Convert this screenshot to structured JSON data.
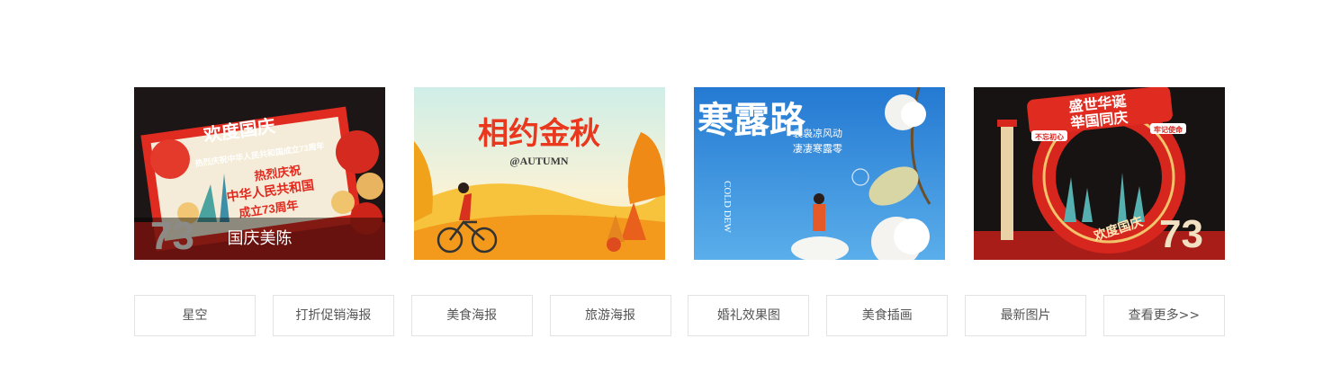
{
  "cards": [
    {
      "caption": "国庆美陈",
      "headline": "欢度国庆",
      "subline": "热烈庆祝中华人民共和国成立73周年",
      "board_line_1": "热烈庆祝",
      "board_line_2": "中华人民共和国",
      "board_line_3": "成立73周年",
      "number": "73"
    },
    {
      "headline": "相约金秋",
      "subline": "@AUTUMN"
    },
    {
      "headline": "寒露路",
      "en": "COLD DEW",
      "poem_1": "袅袅凉风动",
      "poem_2": "凄凄寒露零"
    },
    {
      "headline": "盛世华诞",
      "headline_2": "举国同庆",
      "banner": "欢度国庆",
      "tag_1": "不忘初心",
      "tag_2": "牢记使命",
      "number": "73"
    }
  ],
  "tags": [
    "星空",
    "打折促销海报",
    "美食海报",
    "旅游海报",
    "婚礼效果图",
    "美食插画",
    "最新图片",
    "查看更多>>"
  ],
  "colors": {
    "festive_red": "#d7261e",
    "autumn_orange": "#f29a1d",
    "sky_blue": "#2a86d9",
    "night_black": "#161313"
  }
}
